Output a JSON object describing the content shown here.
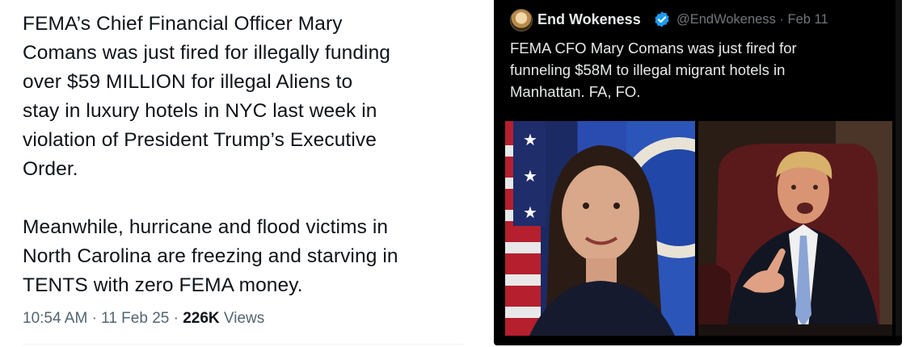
{
  "left_tweet": {
    "paragraph_1": "FEMA’s Chief Financial Officer Mary\nComans was just fired for illegally funding\nover $59 MILLION for illegal Aliens to\nstay in luxury hotels in NYC last week in\nviolation of President Trump’s Executive\nOrder.",
    "paragraph_2": "Meanwhile, hurricane and flood victims in\nNorth Carolina are freezing and starving in\nTENTS with zero FEMA money.",
    "time": "10:54 AM",
    "date": "11 Feb 25",
    "separator": "·",
    "views_count": "226K",
    "views_label": "Views"
  },
  "quoted_tweet": {
    "author_name": "End Wokeness",
    "handle": "@EndWokeness",
    "date": "Feb 11",
    "separator": "·",
    "text": "FEMA CFO Mary Comans was just fired for\nfunneling $58M to illegal migrant hotels in\nManhattan. FA, FO.",
    "verified_badge_color": "#1d9bf0",
    "icons": [
      "avatar",
      "verified-badge-icon"
    ]
  },
  "colors": {
    "left_text": "#0f1419",
    "left_meta": "#536471",
    "dark_bg": "#000000",
    "dark_text": "#e7e9ea",
    "dark_meta": "#71767b"
  }
}
